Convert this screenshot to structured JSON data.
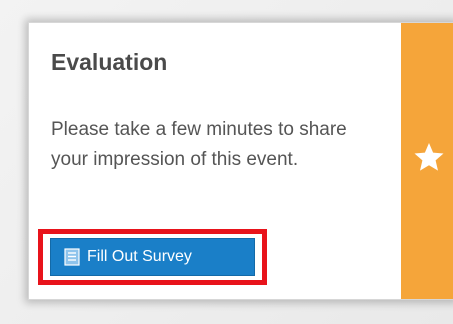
{
  "card": {
    "title": "Evaluation",
    "description": "Please take a few minutes to share your impression of this event.",
    "button_label": "Fill Out Survey",
    "button_icon": "document-icon",
    "accent_icon": "star-icon"
  },
  "colors": {
    "button_bg": "#1a7fc8",
    "accent_strip": "#f5a53a",
    "highlight_border": "#e8131b",
    "title_text": "#4a4a4a"
  }
}
